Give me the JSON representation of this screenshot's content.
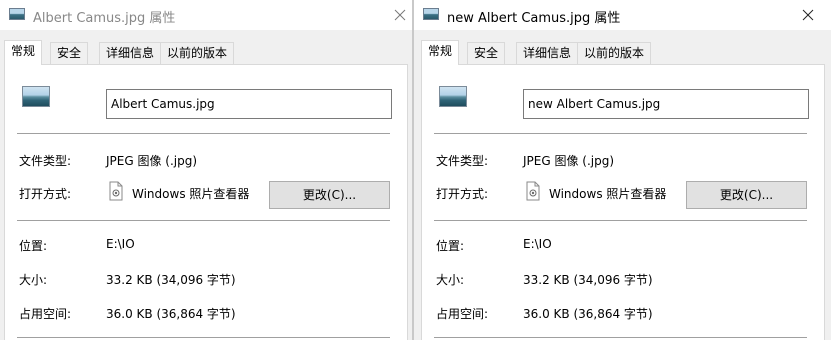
{
  "windows": [
    {
      "title": "Albert Camus.jpg 属性",
      "tabs": [
        "常规",
        "安全",
        "详细信息",
        "以前的版本"
      ],
      "filename": "Albert Camus.jpg",
      "file_type_label": "文件类型:",
      "file_type_value": "JPEG 图像 (.jpg)",
      "open_with_label": "打开方式:",
      "open_with_app": "Windows 照片查看器",
      "change_button": "更改(C)...",
      "location_label": "位置:",
      "location_value": "E:\\IO",
      "size_label": "大小:",
      "size_value": "33.2 KB (34,096 字节)",
      "disk_size_label": "占用空间:",
      "disk_size_value": "36.0 KB (36,864 字节)",
      "title_active": false
    },
    {
      "title": "new Albert Camus.jpg 属性",
      "tabs": [
        "常规",
        "安全",
        "详细信息",
        "以前的版本"
      ],
      "filename": "new Albert Camus.jpg",
      "file_type_label": "文件类型:",
      "file_type_value": "JPEG 图像 (.jpg)",
      "open_with_label": "打开方式:",
      "open_with_app": "Windows 照片查看器",
      "change_button": "更改(C)...",
      "location_label": "位置:",
      "location_value": "E:\\IO",
      "size_label": "大小:",
      "size_value": "33.2 KB (34,096 字节)",
      "disk_size_label": "占用空间:",
      "disk_size_value": "36.0 KB (36,864 字节)",
      "title_active": true
    }
  ],
  "icons": {
    "title": "image-file-icon",
    "close": "close-icon",
    "file": "image-thumbnail-icon",
    "app": "photo-viewer-icon"
  },
  "colors": {
    "window_bg": "#f0f0f0",
    "panel_bg": "#ffffff",
    "inactive_title": "#888888",
    "button_bg": "#e1e1e1",
    "button_border": "#adadad"
  }
}
